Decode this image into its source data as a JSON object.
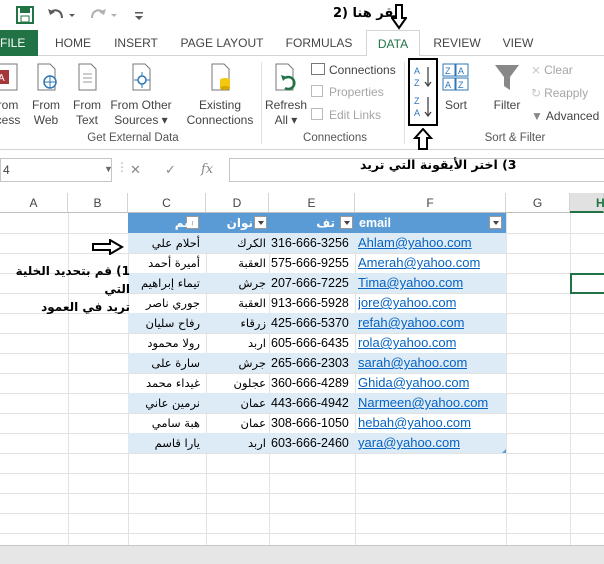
{
  "annotations": {
    "step2": "2) انقر هنا",
    "step3": "3) اختر الأيقونة التي تريد",
    "step1_line1": "1) قم بتحديد الخلية التي",
    "step1_line2": "تريد في العمود"
  },
  "tabs": [
    {
      "label": "FILE"
    },
    {
      "label": "HOME"
    },
    {
      "label": "INSERT"
    },
    {
      "label": "PAGE LAYOUT"
    },
    {
      "label": "FORMULAS"
    },
    {
      "label": "DATA"
    },
    {
      "label": "REVIEW"
    },
    {
      "label": "VIEW"
    }
  ],
  "ribbon": {
    "from_access": [
      "rom",
      "cess"
    ],
    "from_web": [
      "From",
      "Web"
    ],
    "from_text": [
      "From",
      "Text"
    ],
    "from_other": [
      "From Other",
      "Sources ▾"
    ],
    "existing": [
      "Existing",
      "Connections"
    ],
    "group_external": "Get External Data",
    "refresh": [
      "Refresh",
      "All ▾"
    ],
    "connections": "Connections",
    "properties": "Properties",
    "edit_links": "Edit Links",
    "group_connections": "Connections",
    "sort": "Sort",
    "filter": "Filter",
    "clear": "Clear",
    "reapply": "Reapply",
    "advanced": "Advanced",
    "group_sortfilter": "Sort & Filter"
  },
  "formula_bar": {
    "name_box": "4",
    "cancel": "✕",
    "enter": "✓",
    "fx": "fx"
  },
  "columns": [
    "A",
    "B",
    "C",
    "D",
    "E",
    "F",
    "G",
    "H"
  ],
  "table": {
    "headers": {
      "name": "سم",
      "city": "نوان",
      "phone": "تف",
      "email": "email"
    },
    "rows": [
      {
        "name": "أحلام علي",
        "city": "الكرك",
        "phone": "316-666-3256",
        "email": "Ahlam@yahoo.com"
      },
      {
        "name": "أميرة أحمد",
        "city": "العقبة",
        "phone": "575-666-9255",
        "email": "Amerah@yahoo.com"
      },
      {
        "name": "تيماء إبراهيم",
        "city": "جرش",
        "phone": "207-666-7225",
        "email": "Tima@yahoo.com"
      },
      {
        "name": "جوري ناصر",
        "city": "العقبة",
        "phone": "913-666-5928",
        "email": "jore@yahoo.com"
      },
      {
        "name": "رفاح سليان",
        "city": "زرقاء",
        "phone": "425-666-5370",
        "email": "refah@yahoo.com"
      },
      {
        "name": "رولا محمود",
        "city": "اربد",
        "phone": "605-666-6435",
        "email": "rola@yahoo.com"
      },
      {
        "name": "سارة على",
        "city": "جرش",
        "phone": "265-666-2303",
        "email": "sarah@yahoo.com"
      },
      {
        "name": "غيداء محمد",
        "city": "عجلون",
        "phone": "360-666-4289",
        "email": "Ghida@yahoo.com"
      },
      {
        "name": "نرمين عاني",
        "city": "عمان",
        "phone": "443-666-4942",
        "email": "Narmeen@yahoo.com"
      },
      {
        "name": "هبة سامي",
        "city": "عمان",
        "phone": "308-666-1050",
        "email": "hebah@yahoo.com"
      },
      {
        "name": "يارا قاسم",
        "city": "اربد",
        "phone": "603-666-2460",
        "email": "yara@yahoo.com"
      }
    ]
  },
  "colors": {
    "excel_green": "#217346",
    "table_header": "#5b9bd5",
    "band": "#ddebf7",
    "link": "#0563c1"
  }
}
